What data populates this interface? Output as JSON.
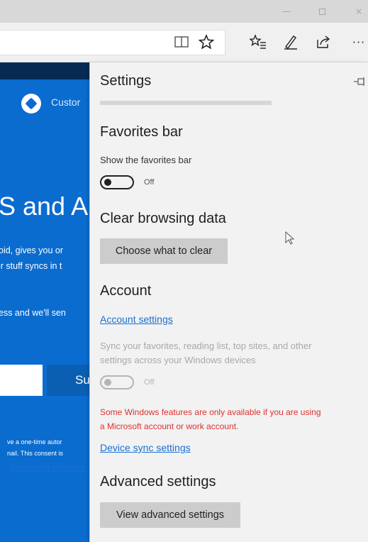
{
  "window": {
    "buttons": [
      "minimize",
      "maximize",
      "close"
    ],
    "close_glyph": "×"
  },
  "toolbar": {
    "icons": [
      "reading-view-icon",
      "favorite-star-icon",
      "favorites-hub-icon",
      "web-note-icon",
      "share-icon",
      "more-icon"
    ],
    "more_glyph": "···"
  },
  "webpage": {
    "logo_text": "Custor",
    "heading": "S and A",
    "body_line1": "oid, gives you or",
    "body_line2": "ir stuff syncs in t",
    "body_line3": "ess and we'll sen",
    "submit_label": "Su",
    "fine_line1": "ve a one-time autor",
    "fine_line2": "nail. This consent is",
    "fine_line3": "Microsoft Privacy S",
    "bg_color": "#0a6ccf"
  },
  "settings": {
    "title": "Settings",
    "favorites_bar": {
      "heading": "Favorites bar",
      "label": "Show the favorites bar",
      "toggle_state": "Off",
      "toggle_on": false
    },
    "clear_browsing": {
      "heading": "Clear browsing data",
      "button_label": "Choose what to clear"
    },
    "account": {
      "heading": "Account",
      "settings_link": "Account settings",
      "sync_desc_line1": "Sync your favorites, reading list, top sites, and other",
      "sync_desc_line2": "settings across your Windows devices",
      "toggle_state": "Off",
      "toggle_on": false,
      "warning_line1": "Some Windows features are only available if you are using",
      "warning_line2": "a Microsoft account or work account.",
      "device_sync_link": "Device sync settings"
    },
    "advanced": {
      "heading": "Advanced settings",
      "button_label": "View advanced settings"
    }
  },
  "colors": {
    "link": "#1a6fd0",
    "warning": "#e03030",
    "panel_bg": "#f2f2f2"
  }
}
